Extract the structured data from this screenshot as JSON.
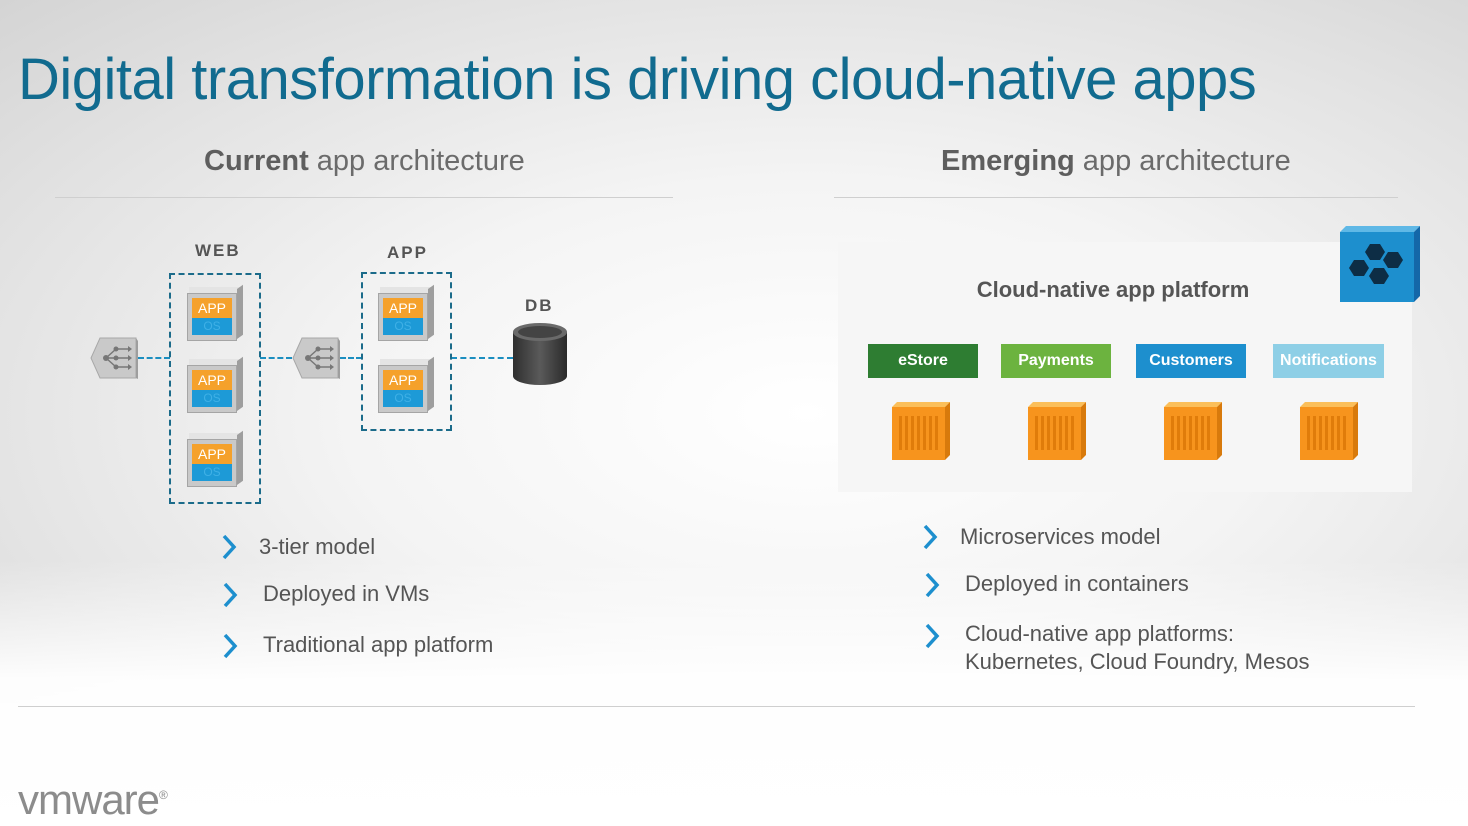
{
  "title": "Digital transformation is driving cloud-native apps",
  "left_section": {
    "heading_bold": "Current",
    "heading_rest": " app architecture",
    "tiers": {
      "web_label": "WEB",
      "app_label": "APP",
      "db_label": "DB"
    },
    "vm_app_text": "APP",
    "vm_os_text": "OS",
    "bullets": [
      "3-tier model",
      "Deployed in VMs",
      "Traditional app platform"
    ]
  },
  "right_section": {
    "heading_bold": "Emerging",
    "heading_rest": " app architecture",
    "platform_title": "Cloud-native app platform",
    "services": [
      {
        "label": "eStore",
        "color": "#2e7d32"
      },
      {
        "label": "Payments",
        "color": "#6cb33f"
      },
      {
        "label": "Customers",
        "color": "#1d8fce"
      },
      {
        "label": "Notifications",
        "color": "#8ecfe6"
      }
    ],
    "bullets": [
      "Microservices model",
      "Deployed in containers"
    ],
    "bullet3_line1": "Cloud-native app platforms:",
    "bullet3_line2": "Kubernetes, Cloud Foundry, Mesos"
  },
  "colors": {
    "title": "#116b8f",
    "accent_blue": "#1d8fce",
    "container_orange": "#f7941d"
  },
  "logo": {
    "text": "vmware",
    "mark": "®"
  }
}
